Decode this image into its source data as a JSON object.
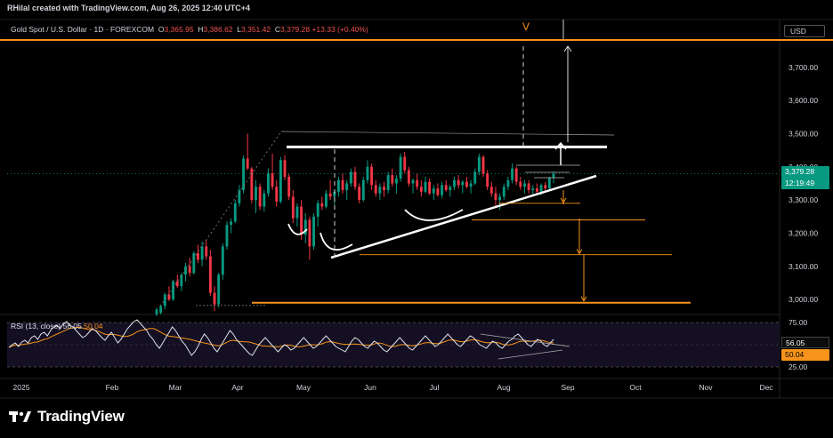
{
  "header": {
    "created_by": "RHilal created with TradingView.com, Aug 26, 2025 12:40 UTC+4"
  },
  "symbol": {
    "name": "Gold Spot / U.S. Dollar · 1D · FOREXCOM",
    "o_label": "O",
    "o_value": "3,365.95",
    "h_label": "H",
    "h_value": "3,386.62",
    "l_label": "L",
    "l_value": "3,351.42",
    "c_label": "C",
    "c_value": "3,379.28",
    "change": "+13.33 (+0.40%)"
  },
  "currency_button": "USD",
  "price_tag": {
    "price": "3,379.28",
    "countdown": "12:19:49"
  },
  "rsi_legend": {
    "name": "RSI (13, close)",
    "value": "56.05",
    "ma_value": "50.04"
  },
  "annotation_marker": "V",
  "brand": "TradingView",
  "colors": {
    "up": "#089981",
    "down": "#f23645",
    "accent": "#f7931a",
    "rsi_line": "#e0e3eb",
    "background": "#000000"
  },
  "chart_data": {
    "type": "candlestick",
    "title": "Gold Spot / U.S. Dollar · 1D · FOREXCOM",
    "x_tick_labels": [
      "2025",
      "Feb",
      "Mar",
      "Apr",
      "May",
      "Jun",
      "Jul",
      "Aug",
      "Sep",
      "Oct",
      "Nov",
      "Dec"
    ],
    "y_tick_labels": [
      "3,700.00",
      "3,600.00",
      "3,500.00",
      "3,400.00",
      "3,300.00",
      "3,200.00",
      "3,100.00",
      "3,000.00"
    ],
    "ylim": [
      2960,
      3780
    ],
    "last_price": 3379.28,
    "candles": [
      {
        "o": 2955,
        "h": 2975,
        "l": 2950,
        "c": 2970
      },
      {
        "o": 2960,
        "h": 2985,
        "l": 2955,
        "c": 2980
      },
      {
        "o": 2980,
        "h": 3020,
        "l": 2970,
        "c": 3015
      },
      {
        "o": 3015,
        "h": 3040,
        "l": 2995,
        "c": 3000
      },
      {
        "o": 3000,
        "h": 3060,
        "l": 2995,
        "c": 3055
      },
      {
        "o": 3055,
        "h": 3075,
        "l": 3035,
        "c": 3040
      },
      {
        "o": 3040,
        "h": 3080,
        "l": 3025,
        "c": 3075
      },
      {
        "o": 3075,
        "h": 3110,
        "l": 3055,
        "c": 3100
      },
      {
        "o": 3100,
        "h": 3125,
        "l": 3070,
        "c": 3080
      },
      {
        "o": 3080,
        "h": 3145,
        "l": 3075,
        "c": 3140
      },
      {
        "o": 3140,
        "h": 3165,
        "l": 3110,
        "c": 3120
      },
      {
        "o": 3120,
        "h": 3175,
        "l": 3100,
        "c": 3160
      },
      {
        "o": 3160,
        "h": 3180,
        "l": 3120,
        "c": 3130
      },
      {
        "o": 3130,
        "h": 3150,
        "l": 3010,
        "c": 3020
      },
      {
        "o": 3020,
        "h": 3040,
        "l": 2965,
        "c": 2985
      },
      {
        "o": 2985,
        "h": 3080,
        "l": 2975,
        "c": 3075
      },
      {
        "o": 3075,
        "h": 3170,
        "l": 3060,
        "c": 3160
      },
      {
        "o": 3160,
        "h": 3235,
        "l": 3150,
        "c": 3225
      },
      {
        "o": 3225,
        "h": 3245,
        "l": 3200,
        "c": 3235
      },
      {
        "o": 3235,
        "h": 3300,
        "l": 3230,
        "c": 3290
      },
      {
        "o": 3290,
        "h": 3345,
        "l": 3280,
        "c": 3330
      },
      {
        "o": 3330,
        "h": 3435,
        "l": 3320,
        "c": 3425
      },
      {
        "o": 3425,
        "h": 3500,
        "l": 3390,
        "c": 3395
      },
      {
        "o": 3395,
        "h": 3400,
        "l": 3290,
        "c": 3300
      },
      {
        "o": 3300,
        "h": 3360,
        "l": 3260,
        "c": 3340
      },
      {
        "o": 3340,
        "h": 3350,
        "l": 3270,
        "c": 3280
      },
      {
        "o": 3280,
        "h": 3330,
        "l": 3265,
        "c": 3320
      },
      {
        "o": 3320,
        "h": 3395,
        "l": 3310,
        "c": 3380
      },
      {
        "o": 3380,
        "h": 3440,
        "l": 3330,
        "c": 3340
      },
      {
        "o": 3340,
        "h": 3360,
        "l": 3280,
        "c": 3295
      },
      {
        "o": 3295,
        "h": 3430,
        "l": 3290,
        "c": 3420
      },
      {
        "o": 3420,
        "h": 3435,
        "l": 3360,
        "c": 3370
      },
      {
        "o": 3370,
        "h": 3380,
        "l": 3300,
        "c": 3310
      },
      {
        "o": 3310,
        "h": 3330,
        "l": 3230,
        "c": 3245
      },
      {
        "o": 3245,
        "h": 3290,
        "l": 3220,
        "c": 3280
      },
      {
        "o": 3280,
        "h": 3300,
        "l": 3180,
        "c": 3195
      },
      {
        "o": 3195,
        "h": 3260,
        "l": 3170,
        "c": 3240
      },
      {
        "o": 3240,
        "h": 3250,
        "l": 3120,
        "c": 3160
      },
      {
        "o": 3160,
        "h": 3260,
        "l": 3150,
        "c": 3250
      },
      {
        "o": 3250,
        "h": 3300,
        "l": 3220,
        "c": 3290
      },
      {
        "o": 3290,
        "h": 3310,
        "l": 3270,
        "c": 3280
      },
      {
        "o": 3280,
        "h": 3330,
        "l": 3275,
        "c": 3320
      },
      {
        "o": 3320,
        "h": 3360,
        "l": 3300,
        "c": 3310
      },
      {
        "o": 3310,
        "h": 3330,
        "l": 3285,
        "c": 3325
      },
      {
        "o": 3325,
        "h": 3370,
        "l": 3310,
        "c": 3360
      },
      {
        "o": 3360,
        "h": 3380,
        "l": 3320,
        "c": 3330
      },
      {
        "o": 3330,
        "h": 3360,
        "l": 3300,
        "c": 3350
      },
      {
        "o": 3350,
        "h": 3395,
        "l": 3340,
        "c": 3385
      },
      {
        "o": 3385,
        "h": 3400,
        "l": 3330,
        "c": 3340
      },
      {
        "o": 3340,
        "h": 3350,
        "l": 3290,
        "c": 3300
      },
      {
        "o": 3300,
        "h": 3370,
        "l": 3295,
        "c": 3360
      },
      {
        "o": 3360,
        "h": 3420,
        "l": 3350,
        "c": 3400
      },
      {
        "o": 3400,
        "h": 3410,
        "l": 3330,
        "c": 3345
      },
      {
        "o": 3345,
        "h": 3360,
        "l": 3310,
        "c": 3320
      },
      {
        "o": 3320,
        "h": 3350,
        "l": 3300,
        "c": 3340
      },
      {
        "o": 3340,
        "h": 3355,
        "l": 3310,
        "c": 3330
      },
      {
        "o": 3330,
        "h": 3385,
        "l": 3320,
        "c": 3375
      },
      {
        "o": 3375,
        "h": 3395,
        "l": 3340,
        "c": 3350
      },
      {
        "o": 3350,
        "h": 3375,
        "l": 3320,
        "c": 3365
      },
      {
        "o": 3365,
        "h": 3440,
        "l": 3355,
        "c": 3430
      },
      {
        "o": 3430,
        "h": 3445,
        "l": 3380,
        "c": 3390
      },
      {
        "o": 3390,
        "h": 3400,
        "l": 3340,
        "c": 3350
      },
      {
        "o": 3350,
        "h": 3365,
        "l": 3320,
        "c": 3360
      },
      {
        "o": 3360,
        "h": 3380,
        "l": 3330,
        "c": 3340
      },
      {
        "o": 3340,
        "h": 3360,
        "l": 3310,
        "c": 3325
      },
      {
        "o": 3325,
        "h": 3370,
        "l": 3320,
        "c": 3355
      },
      {
        "o": 3355,
        "h": 3365,
        "l": 3315,
        "c": 3320
      },
      {
        "o": 3320,
        "h": 3345,
        "l": 3300,
        "c": 3335
      },
      {
        "o": 3335,
        "h": 3350,
        "l": 3310,
        "c": 3315
      },
      {
        "o": 3315,
        "h": 3355,
        "l": 3305,
        "c": 3345
      },
      {
        "o": 3345,
        "h": 3360,
        "l": 3325,
        "c": 3330
      },
      {
        "o": 3330,
        "h": 3345,
        "l": 3310,
        "c": 3340
      },
      {
        "o": 3340,
        "h": 3370,
        "l": 3330,
        "c": 3360
      },
      {
        "o": 3360,
        "h": 3375,
        "l": 3335,
        "c": 3345
      },
      {
        "o": 3345,
        "h": 3360,
        "l": 3320,
        "c": 3355
      },
      {
        "o": 3355,
        "h": 3370,
        "l": 3335,
        "c": 3340
      },
      {
        "o": 3340,
        "h": 3360,
        "l": 3320,
        "c": 3350
      },
      {
        "o": 3350,
        "h": 3395,
        "l": 3345,
        "c": 3385
      },
      {
        "o": 3385,
        "h": 3440,
        "l": 3375,
        "c": 3430
      },
      {
        "o": 3430,
        "h": 3435,
        "l": 3370,
        "c": 3380
      },
      {
        "o": 3380,
        "h": 3390,
        "l": 3330,
        "c": 3340
      },
      {
        "o": 3340,
        "h": 3355,
        "l": 3310,
        "c": 3320
      },
      {
        "o": 3320,
        "h": 3340,
        "l": 3280,
        "c": 3300
      },
      {
        "o": 3300,
        "h": 3320,
        "l": 3270,
        "c": 3310
      },
      {
        "o": 3310,
        "h": 3350,
        "l": 3300,
        "c": 3340
      },
      {
        "o": 3340,
        "h": 3370,
        "l": 3330,
        "c": 3360
      },
      {
        "o": 3360,
        "h": 3410,
        "l": 3350,
        "c": 3395
      },
      {
        "o": 3395,
        "h": 3400,
        "l": 3345,
        "c": 3355
      },
      {
        "o": 3355,
        "h": 3370,
        "l": 3330,
        "c": 3340
      },
      {
        "o": 3340,
        "h": 3360,
        "l": 3320,
        "c": 3350
      },
      {
        "o": 3350,
        "h": 3360,
        "l": 3320,
        "c": 3330
      },
      {
        "o": 3330,
        "h": 3345,
        "l": 3315,
        "c": 3335
      },
      {
        "o": 3335,
        "h": 3350,
        "l": 3320,
        "c": 3325
      },
      {
        "o": 3325,
        "h": 3350,
        "l": 3315,
        "c": 3345
      },
      {
        "o": 3345,
        "h": 3355,
        "l": 3325,
        "c": 3335
      },
      {
        "o": 3335,
        "h": 3370,
        "l": 3330,
        "c": 3366
      },
      {
        "o": 3366,
        "h": 3387,
        "l": 3351,
        "c": 3379
      }
    ],
    "levels": [
      3460,
      3290,
      3240,
      3135,
      2990
    ],
    "rsi": {
      "name": "RSI (13, close)",
      "ylim": [
        22,
        82
      ],
      "y_tick_labels": [
        "75.00",
        "50.00",
        "25.00"
      ],
      "last": 56.05,
      "ma_last": 50.04,
      "values": [
        47,
        50,
        52,
        48,
        53,
        55,
        52,
        58,
        60,
        56,
        62,
        64,
        60,
        66,
        70,
        72,
        68,
        74,
        76,
        72,
        70,
        66,
        62,
        58,
        60,
        64,
        68,
        66,
        62,
        58,
        55,
        60,
        64,
        58,
        52,
        56,
        62,
        68,
        72,
        76,
        78,
        74,
        70,
        66,
        60,
        56,
        50,
        46,
        52,
        58,
        64,
        70,
        66,
        60,
        54,
        50,
        44,
        38,
        42,
        48,
        56,
        62,
        58,
        52,
        46,
        42,
        48,
        54,
        60,
        66,
        62,
        56,
        52,
        48,
        44,
        40,
        38,
        44,
        50,
        54,
        58,
        54,
        50,
        46,
        42,
        46,
        50,
        48,
        44,
        46,
        50,
        54,
        58,
        54,
        50,
        46,
        48,
        52,
        56,
        60,
        56,
        52,
        48,
        46,
        44,
        42,
        48,
        54,
        58,
        56,
        52,
        48,
        46,
        50,
        54,
        52,
        48,
        44,
        42,
        46,
        50,
        54,
        58,
        54,
        50,
        46,
        44,
        48,
        52,
        56,
        60,
        56,
        52,
        48,
        50,
        54,
        58,
        62,
        58,
        54,
        50,
        48,
        52,
        56,
        60,
        58,
        54,
        50,
        48,
        46,
        50,
        54,
        52,
        48,
        46,
        50,
        54,
        56,
        60,
        62,
        58,
        54,
        50,
        48,
        52,
        56,
        54,
        50,
        48,
        52,
        56
      ]
    }
  }
}
